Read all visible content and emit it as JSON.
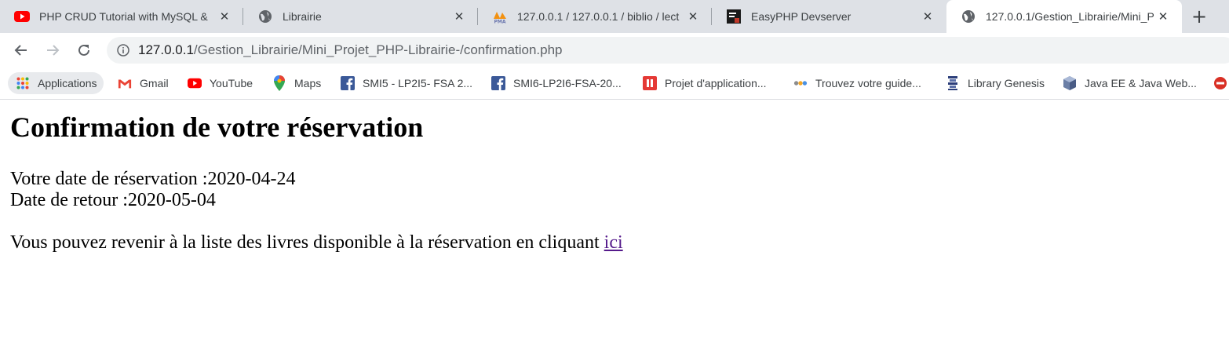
{
  "browser": {
    "tabs": [
      {
        "title": "PHP CRUD Tutorial with MySQL &",
        "icon": "youtube-icon"
      },
      {
        "title": "Librairie",
        "icon": "globe-icon"
      },
      {
        "title": "127.0.0.1 / 127.0.0.1 / biblio / lect",
        "icon": "phpmyadmin-icon"
      },
      {
        "title": "EasyPHP Devserver",
        "icon": "easyphp-icon"
      },
      {
        "title": "127.0.0.1/Gestion_Librairie/Mini_P",
        "icon": "globe-icon",
        "active": true
      }
    ],
    "new_tab_label": "+",
    "address": {
      "host": "127.0.0.1",
      "path": "/Gestion_Librairie/Mini_Projet_PHP-Librairie-/confirmation.php"
    },
    "bookmarks": [
      {
        "label": "Applications",
        "icon": "apps-grid-icon"
      },
      {
        "label": "Gmail",
        "icon": "gmail-icon"
      },
      {
        "label": "YouTube",
        "icon": "youtube-icon"
      },
      {
        "label": "Maps",
        "icon": "maps-pin-icon"
      },
      {
        "label": "SMI5 - LP2I5- FSA 2...",
        "icon": "facebook-icon"
      },
      {
        "label": "SMI6-LP2I6-FSA-20...",
        "icon": "facebook-icon"
      },
      {
        "label": "Projet d'application...",
        "icon": "project-icon"
      },
      {
        "label": "Trouvez votre guide...",
        "icon": "guide-icon"
      },
      {
        "label": "Library Genesis",
        "icon": "library-genesis-icon"
      },
      {
        "label": "Java EE & Java Web...",
        "icon": "java-icon"
      }
    ]
  },
  "page": {
    "heading": "Confirmation de votre réservation",
    "reservation_date_line": "Votre date de réservation :2020-04-24",
    "return_date_line": "Date de retour :2020-05-04",
    "return_message": "Vous pouvez revenir à la liste des livres disponible à la réservation en cliquant ",
    "link_text": "ici"
  },
  "colors": {
    "tabstrip": "#dee1e6",
    "omnibox": "#f1f3f4",
    "link": "#551a8b"
  }
}
